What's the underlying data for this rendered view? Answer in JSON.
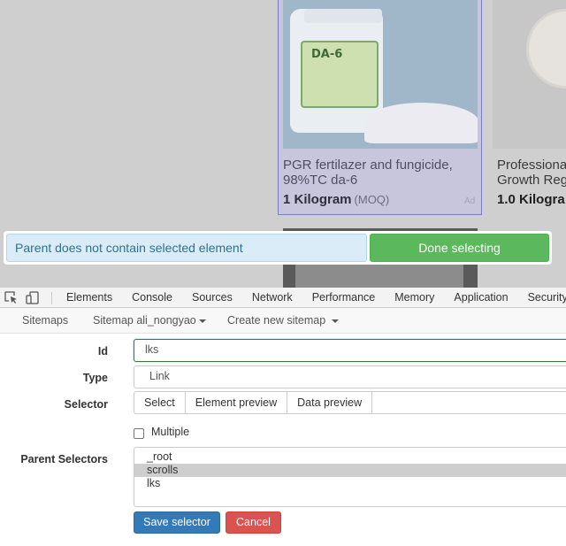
{
  "page": {
    "product1": {
      "image_label": "DA-6",
      "title": "PGR fertilazer and fungicide, 98%TC da-6",
      "moq_amount": "1 Kilogram",
      "moq_suffix": "(MOQ)",
      "ad": "Ad"
    },
    "product2": {
      "title_line1": "Professiona",
      "title_line2": "Growth Reg",
      "moq_amount": "1.0 Kilogra"
    }
  },
  "selection_bar": {
    "message": "Parent does not contain selected element",
    "done_label": "Done selecting"
  },
  "devtools": {
    "tabs": [
      "Elements",
      "Console",
      "Sources",
      "Network",
      "Performance",
      "Memory",
      "Application",
      "Security"
    ],
    "icons": [
      "inspect-icon",
      "device-toolbar-icon"
    ]
  },
  "scraper_nav": {
    "sitemaps": "Sitemaps",
    "current_sitemap": "Sitemap ali_nongyao",
    "create_sitemap": "Create new sitemap"
  },
  "form": {
    "id_label": "Id",
    "id_value": "lks",
    "type_label": "Type",
    "type_value": "Link",
    "selector_label": "Selector",
    "selector_buttons": [
      "Select",
      "Element preview",
      "Data preview"
    ],
    "multiple_label": "Multiple",
    "multiple_checked": false,
    "parent_label": "Parent Selectors",
    "parent_options": [
      {
        "label": "_root",
        "selected": false
      },
      {
        "label": "scrolls",
        "selected": true
      },
      {
        "label": "lks",
        "selected": false
      }
    ],
    "save_label": "Save selector",
    "cancel_label": "Cancel"
  },
  "colors": {
    "done_green": "#5cb85c",
    "save_blue": "#337ab7",
    "cancel_red": "#d9534f",
    "highlight": "#7d7ac9"
  }
}
